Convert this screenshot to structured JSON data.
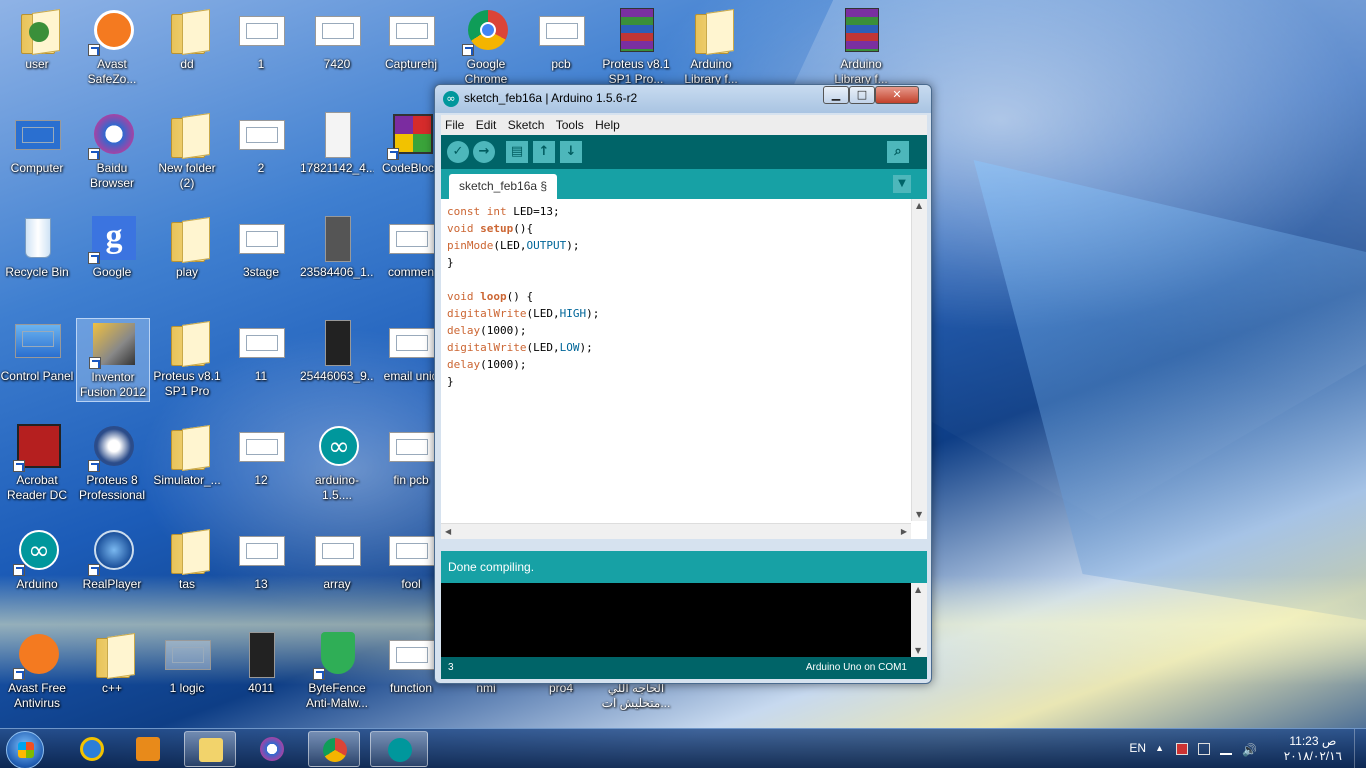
{
  "desktop": {
    "icons": [
      {
        "label": "user"
      },
      {
        "label": "Avast SafeZo..."
      },
      {
        "label": "dd"
      },
      {
        "label": "1"
      },
      {
        "label": "7420"
      },
      {
        "label": "Capturehj"
      },
      {
        "label": "Google Chrome"
      },
      {
        "label": "pcb"
      },
      {
        "label": "Proteus v8.1 SP1 Pro..."
      },
      {
        "label": "Arduino Library f..."
      },
      {
        "label": "Arduino Library f..."
      },
      {
        "label": "Computer"
      },
      {
        "label": "Baidu Browser"
      },
      {
        "label": "New folder (2)"
      },
      {
        "label": "2"
      },
      {
        "label": "17821142_4..."
      },
      {
        "label": "CodeBlock"
      },
      {
        "label": "Recycle Bin"
      },
      {
        "label": "Google"
      },
      {
        "label": "play"
      },
      {
        "label": "3stage"
      },
      {
        "label": "23584406_1..."
      },
      {
        "label": "commen"
      },
      {
        "label": "Control Panel"
      },
      {
        "label": "Inventor Fusion 2012"
      },
      {
        "label": "Proteus v8.1 SP1 Pro"
      },
      {
        "label": "11"
      },
      {
        "label": "25446063_9..."
      },
      {
        "label": "email uniq"
      },
      {
        "label": "Acrobat Reader DC"
      },
      {
        "label": "Proteus 8 Professional"
      },
      {
        "label": "Simulator_..."
      },
      {
        "label": "12"
      },
      {
        "label": "arduino-1.5...."
      },
      {
        "label": "fin pcb"
      },
      {
        "label": "Arduino"
      },
      {
        "label": "RealPlayer"
      },
      {
        "label": "tas"
      },
      {
        "label": "13"
      },
      {
        "label": "array"
      },
      {
        "label": "fool"
      },
      {
        "label": "Avast Free Antivirus"
      },
      {
        "label": "c++"
      },
      {
        "label": "1 logic"
      },
      {
        "label": "4011"
      },
      {
        "label": "ByteFence Anti-Malw..."
      },
      {
        "label": "function"
      },
      {
        "label": "nmi"
      },
      {
        "label": "pro4"
      },
      {
        "label": "الحاجه اللي متخليش ات..."
      }
    ]
  },
  "window": {
    "title": "sketch_feb16a | Arduino 1.5.6-r2",
    "controls": {
      "minimize": "▁",
      "maximize": "□",
      "close": "✕"
    },
    "menu": [
      "File",
      "Edit",
      "Sketch",
      "Tools",
      "Help"
    ],
    "toolbar": {
      "verify": "✓",
      "upload": "→",
      "new": "▤",
      "open": "↑",
      "save": "↓",
      "serial": "⌕"
    },
    "tab_label": "sketch_feb16a §",
    "tab_menu": "▼",
    "code": {
      "l1_kw": "const int",
      "l1_rest": " LED=13;",
      "l2_kw": "void",
      "l2_fn": "setup",
      "l2_rest": "(){",
      "l3_fn": "pinMode",
      "l3_a": "(LED,",
      "l3_c": "OUTPUT",
      "l3_b": ");",
      "l4": "}",
      "l6_kw": "void",
      "l6_fn": "loop",
      "l6_rest": "() {",
      "l7_fn": "digitalWrite",
      "l7_a": "(LED,",
      "l7_c": "HIGH",
      "l7_b": ");",
      "l8_fn": "delay",
      "l8_a": "(1000);",
      "l9_fn": "digitalWrite",
      "l9_a": "(LED,",
      "l9_c": "LOW",
      "l9_b": ");",
      "l10_fn": "delay",
      "l10_a": "(1000);",
      "l11": "}"
    },
    "status": "Done compiling.",
    "line_number": "3",
    "board": "Arduino Uno on COM1"
  },
  "taskbar": {
    "language": "EN",
    "time": "11:23 ص",
    "date": "٢٠١٨/٠٢/١٦"
  },
  "colors": {
    "arduino_teal": "#00979c",
    "toolbar_dark": "#006468",
    "keyword": "#cc6633",
    "constant": "#006699"
  }
}
